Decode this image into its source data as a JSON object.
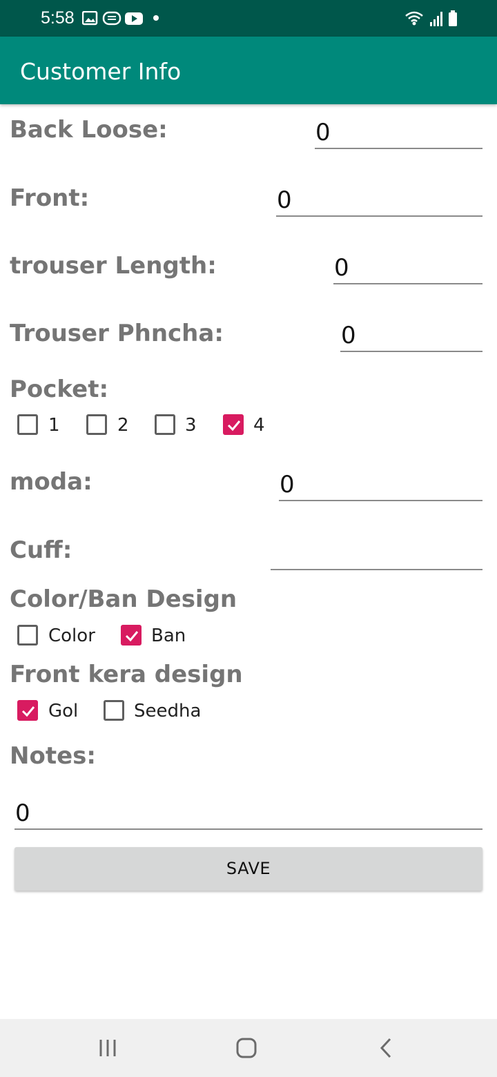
{
  "status_bar": {
    "time": "5:58"
  },
  "app_bar": {
    "title": "Customer Info"
  },
  "form": {
    "back_loose": {
      "label": "Back Loose:",
      "value": "0"
    },
    "front": {
      "label": "Front:",
      "value": "0"
    },
    "trouser_length": {
      "label": "trouser Length:",
      "value": "0"
    },
    "trouser_phncha": {
      "label": "Trouser Phncha:",
      "value": "0"
    },
    "pocket": {
      "label": "Pocket:",
      "options": [
        {
          "label": "1",
          "checked": false
        },
        {
          "label": "2",
          "checked": false
        },
        {
          "label": "3",
          "checked": false
        },
        {
          "label": "4",
          "checked": true
        }
      ]
    },
    "moda": {
      "label": "moda:",
      "value": "0"
    },
    "cuff": {
      "label": "Cuff:",
      "value": ""
    },
    "color_ban": {
      "label": "Color/Ban Design",
      "options": [
        {
          "label": "Color",
          "checked": false
        },
        {
          "label": "Ban",
          "checked": true
        }
      ]
    },
    "front_kera": {
      "label": "Front kera design",
      "options": [
        {
          "label": "Gol",
          "checked": true
        },
        {
          "label": "Seedha",
          "checked": false
        }
      ]
    },
    "notes": {
      "label": "Notes:",
      "value": "0"
    },
    "save_label": "SAVE"
  },
  "colors": {
    "status_bar": "#00574b",
    "app_bar": "#00897b",
    "checkbox_accent": "#d81b60"
  }
}
